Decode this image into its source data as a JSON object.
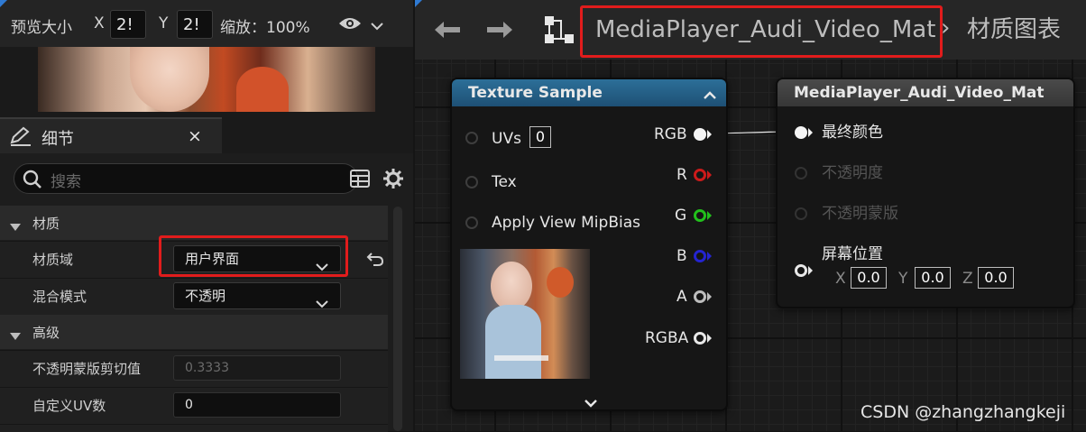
{
  "preview": {
    "label": "预览大小",
    "x_label": "X",
    "x_value": "2!",
    "y_label": "Y",
    "y_value": "2!",
    "zoom": "缩放：100%"
  },
  "details": {
    "tab_label": "细节",
    "close": "×",
    "search_placeholder": "搜索",
    "sections": {
      "material": {
        "title": "材质",
        "domain_label": "材质域",
        "domain_value": "用户界面",
        "blend_label": "混合模式",
        "blend_value": "不透明"
      },
      "advanced": {
        "title": "高级",
        "clip_label": "不透明蒙版剪切值",
        "clip_value": "0.3333",
        "uv_label": "自定义UV数",
        "uv_value": "0"
      }
    }
  },
  "breadcrumb": {
    "material_name": "MediaPlayer_Audi_Video_Mat",
    "separator": "›",
    "graph": "材质图表"
  },
  "texture_node": {
    "title": "Texture Sample",
    "inputs": {
      "uvs": "UVs",
      "uvs_value": "0",
      "tex": "Tex",
      "mip": "Apply View MipBias"
    },
    "outputs": {
      "rgb": "RGB",
      "r": "R",
      "g": "G",
      "b": "B",
      "a": "A",
      "rgba": "RGBA"
    },
    "header_color": "#1f5e84"
  },
  "material_node": {
    "title": "MediaPlayer_Audi_Video_Mat",
    "pins": {
      "final_color": "最终颜色",
      "opacity": "不透明度",
      "opacity_mask": "不透明蒙版",
      "screen_position": "屏幕位置"
    },
    "screen_pos": {
      "x_label": "X",
      "x": "0.0",
      "y_label": "Y",
      "y": "0.0",
      "z_label": "Z",
      "z": "0.0"
    },
    "header_color": "#3d3d3d"
  },
  "watermark": "CSDN @zhangzhangkeji",
  "colors": {
    "highlight": "#e11c1c",
    "r": "#cc1b1b",
    "g": "#22c01c",
    "b": "#2424d0"
  }
}
